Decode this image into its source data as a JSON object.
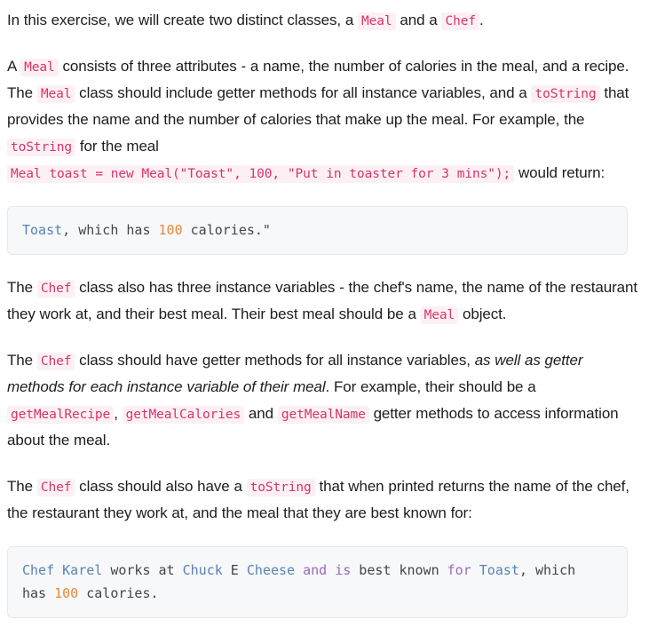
{
  "document": {
    "type": "markdown-exercise-prompt",
    "colors": {
      "page_background": "#ffffff",
      "body_text": "#1d1d1f",
      "inline_code_text": "#d6336c",
      "inline_code_background": "#fdf0f4",
      "code_block_background": "#f6f8fa",
      "code_block_border": "#e6e8eb",
      "code_string": "#5b82b0",
      "code_number": "#e8883a",
      "code_keyword": "#9a6bb5",
      "code_plain": "#454545"
    },
    "blocks": [
      {
        "id": "intro",
        "kind": "paragraph",
        "runs": [
          {
            "text": "In this exercise, we will create two distinct classes, a ",
            "style": "plain"
          },
          {
            "text": "Meal",
            "style": "code"
          },
          {
            "text": " and a ",
            "style": "plain"
          },
          {
            "text": "Chef",
            "style": "code"
          },
          {
            "text": ".",
            "style": "plain"
          }
        ]
      },
      {
        "id": "meal-description",
        "kind": "paragraph",
        "runs": [
          {
            "text": "A ",
            "style": "plain"
          },
          {
            "text": "Meal",
            "style": "code"
          },
          {
            "text": " consists of three attributes - a name, the number of calories in the meal, and a recipe. The ",
            "style": "plain"
          },
          {
            "text": "Meal",
            "style": "code"
          },
          {
            "text": " class should include getter methods for all instance variables, and a ",
            "style": "plain"
          },
          {
            "text": "toString",
            "style": "code"
          },
          {
            "text": " that provides the name and the number of calories that make up the meal. For example, the ",
            "style": "plain"
          },
          {
            "text": "toString",
            "style": "code"
          },
          {
            "text": " for the meal ",
            "style": "plain"
          },
          {
            "text": "Meal toast = new Meal(\"Toast\", 100, \"Put in toaster for 3 mins\");",
            "style": "code"
          },
          {
            "text": " would return:",
            "style": "plain"
          }
        ]
      },
      {
        "id": "meal-tostring-output",
        "kind": "codeblock",
        "lines": [
          [
            {
              "text": "Toast",
              "token": "string"
            },
            {
              "text": ", which has ",
              "token": "plain"
            },
            {
              "text": "100",
              "token": "number"
            },
            {
              "text": " calories.\"",
              "token": "plain"
            }
          ]
        ]
      },
      {
        "id": "chef-variables",
        "kind": "paragraph",
        "runs": [
          {
            "text": "The ",
            "style": "plain"
          },
          {
            "text": "Chef",
            "style": "code"
          },
          {
            "text": " class also has three instance variables - the chef's name, the name of the restaurant they work at, and their best meal. Their best meal should be a ",
            "style": "plain"
          },
          {
            "text": "Meal",
            "style": "code"
          },
          {
            "text": " object.",
            "style": "plain"
          }
        ]
      },
      {
        "id": "chef-getters",
        "kind": "paragraph",
        "runs": [
          {
            "text": "The ",
            "style": "plain"
          },
          {
            "text": "Chef",
            "style": "code"
          },
          {
            "text": " class should have getter methods for all instance variables, ",
            "style": "plain"
          },
          {
            "text": "as well as getter methods for each instance variable of their meal",
            "style": "italic"
          },
          {
            "text": ". For example, their should be a ",
            "style": "plain"
          },
          {
            "text": "getMealRecipe",
            "style": "code"
          },
          {
            "text": ", ",
            "style": "plain"
          },
          {
            "text": "getMealCalories",
            "style": "code"
          },
          {
            "text": " and ",
            "style": "plain"
          },
          {
            "text": "getMealName",
            "style": "code"
          },
          {
            "text": " getter methods to access information about the meal.",
            "style": "plain"
          }
        ]
      },
      {
        "id": "chef-tostring",
        "kind": "paragraph",
        "runs": [
          {
            "text": "The ",
            "style": "plain"
          },
          {
            "text": "Chef",
            "style": "code"
          },
          {
            "text": " class should also have a ",
            "style": "plain"
          },
          {
            "text": "toString",
            "style": "code"
          },
          {
            "text": " that when printed returns the name of the chef, the restaurant they work at, and the meal that they are best known for:",
            "style": "plain"
          }
        ]
      },
      {
        "id": "chef-tostring-output",
        "kind": "codeblock",
        "lines": [
          [
            {
              "text": "Chef Karel",
              "token": "string"
            },
            {
              "text": " works at ",
              "token": "plain"
            },
            {
              "text": "Chuck",
              "token": "string"
            },
            {
              "text": " E ",
              "token": "plain"
            },
            {
              "text": "Cheese",
              "token": "string"
            },
            {
              "text": " ",
              "token": "plain"
            },
            {
              "text": "and",
              "token": "keyword"
            },
            {
              "text": " ",
              "token": "plain"
            },
            {
              "text": "is",
              "token": "keyword"
            },
            {
              "text": " best known ",
              "token": "plain"
            },
            {
              "text": "for",
              "token": "keyword"
            },
            {
              "text": " ",
              "token": "plain"
            },
            {
              "text": "Toast",
              "token": "string"
            },
            {
              "text": ", which",
              "token": "plain"
            }
          ],
          [
            {
              "text": "has ",
              "token": "plain"
            },
            {
              "text": "100",
              "token": "number"
            },
            {
              "text": " calories.",
              "token": "plain"
            }
          ]
        ]
      }
    ]
  }
}
